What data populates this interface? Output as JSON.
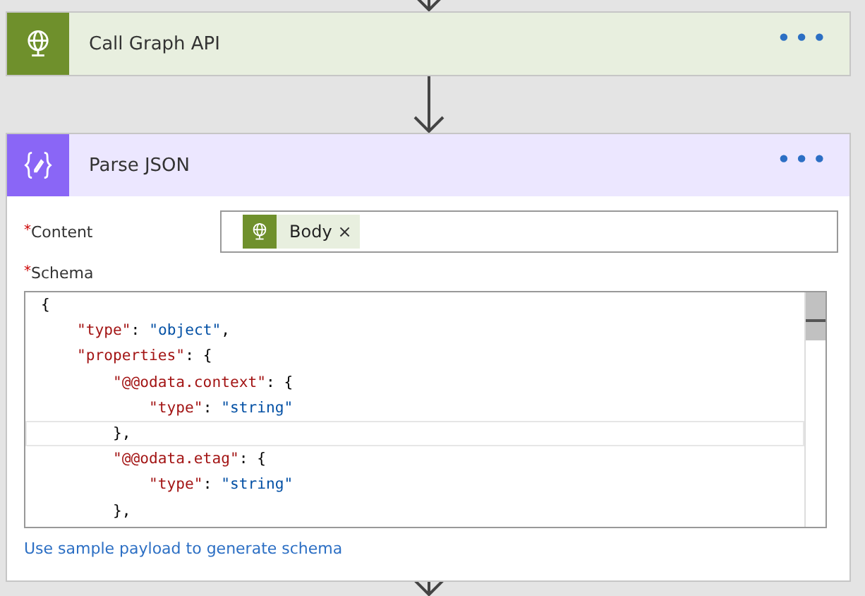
{
  "steps": [
    {
      "kind": "http",
      "title": "Call Graph API",
      "color": "#6f902c",
      "menu": "•••"
    },
    {
      "kind": "parse",
      "title": "Parse JSON",
      "color": "#8a66f6",
      "menu": "•••",
      "fields": [
        {
          "label": "Content",
          "required_mark": "*",
          "tokens": [
            {
              "label": "Body",
              "color": "#6f902c",
              "remove": "×"
            }
          ]
        }
      ],
      "schema": {
        "label": "Schema",
        "required_mark": "*",
        "lines": [
          {
            "text": "{",
            "selected": false
          },
          {
            "text": "    \"type\": \"object\",",
            "selected": false
          },
          {
            "text": "    \"properties\": {",
            "selected": false
          },
          {
            "text": "        \"@@odata.context\": {",
            "selected": false
          },
          {
            "text": "            \"type\": \"string\"",
            "selected": false
          },
          {
            "text": "        },",
            "selected": true
          },
          {
            "text": "        \"@@odata.etag\": {",
            "selected": false
          },
          {
            "text": "            \"type\": \"string\"",
            "selected": false
          },
          {
            "text": "        },",
            "selected": false
          }
        ]
      },
      "link": "Use sample payload to generate schema"
    }
  ]
}
